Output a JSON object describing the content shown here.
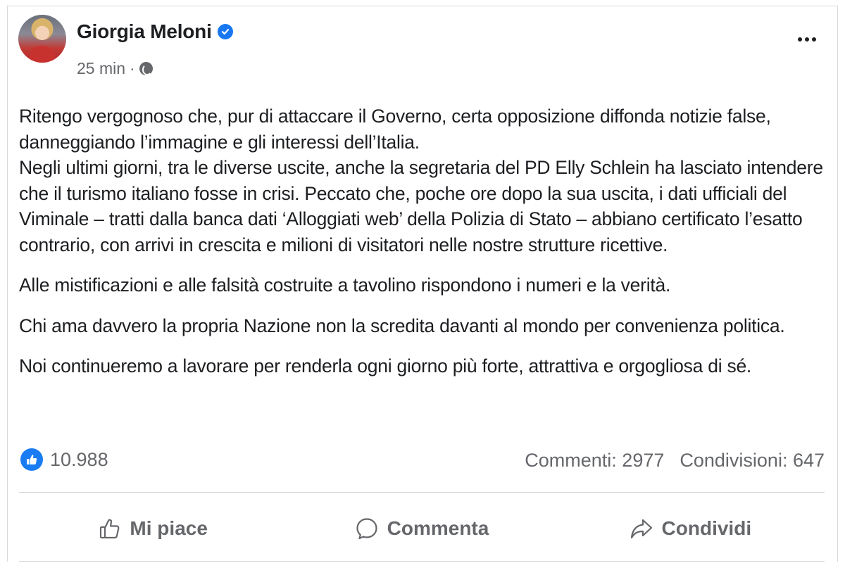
{
  "post": {
    "author": "Giorgia Meloni",
    "time": "25 min",
    "separator": "·",
    "paragraphs": [
      {
        "lines": [
          "Ritengo vergognoso che, pur di attaccare il Governo, certa opposizione diffonda notizie false,",
          "danneggiando l’immagine e gli interessi dell’Italia.",
          "Negli ultimi giorni, tra le diverse uscite, anche la segretaria del PD Elly Schlein ha lasciato intendere",
          "che il turismo italiano fosse in crisi. Peccato che, poche ore dopo la sua uscita, i dati ufficiali del",
          "Viminale – tratti dalla banca dati ‘Alloggiati web’ della Polizia di Stato – abbiano certificato l’esatto",
          "contrario, con arrivi in crescita e milioni di visitatori nelle nostre strutture ricettive."
        ]
      },
      {
        "lines": [
          "Alle mistificazioni e alle falsità costruite a tavolino rispondono i numeri e la verità."
        ]
      },
      {
        "lines": [
          "Chi ama davvero la propria Nazione non la scredita davanti al mondo per convenienza politica."
        ]
      },
      {
        "lines": [
          "Noi continueremo a lavorare per renderla ogni giorno più forte, attrattiva e orgogliosa di sé."
        ]
      }
    ]
  },
  "engagement": {
    "likes": "10.988",
    "comments": "Commenti: 2977",
    "shares": "Condivisioni: 647"
  },
  "actions": {
    "like": "Mi piace",
    "comment": "Commenta",
    "share": "Condividi"
  },
  "icons": {
    "verified": "verified-badge-icon",
    "privacy": "globe-icon",
    "menu": "more-options-icon",
    "reaction": "like-reaction-icon"
  },
  "colors": {
    "accent": "#1877f2",
    "secondary_text": "#65676b",
    "primary_text": "#1c1e21"
  }
}
